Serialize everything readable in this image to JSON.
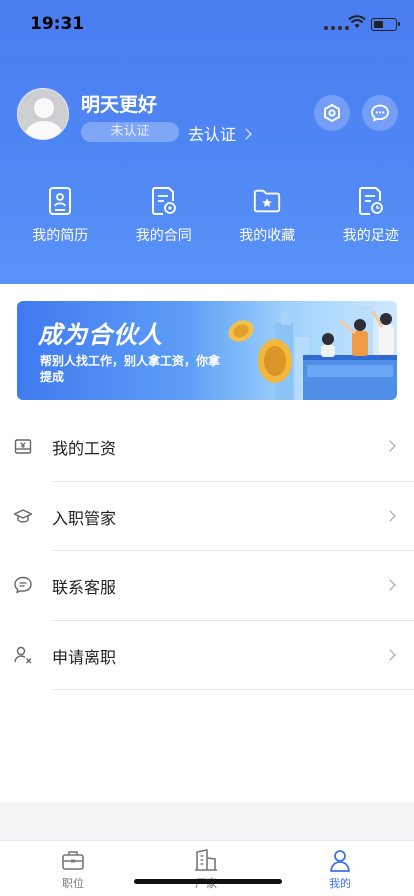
{
  "status": {
    "time": "19:31"
  },
  "profile": {
    "name": "明天更好",
    "badge": "未认证",
    "verify_link": "去认证"
  },
  "shortcuts": [
    {
      "label": "我的简历",
      "icon": "resume-icon"
    },
    {
      "label": "我的合同",
      "icon": "contract-icon"
    },
    {
      "label": "我的收藏",
      "icon": "favorites-folder-icon"
    },
    {
      "label": "我的足迹",
      "icon": "history-icon"
    }
  ],
  "banner": {
    "title": "成为合伙人",
    "subtitle": "帮别人找工作，别人拿工资，你拿提成"
  },
  "menu": [
    {
      "label": "我的工资",
      "icon": "salary-icon"
    },
    {
      "label": "入职管家",
      "icon": "onboarding-icon"
    },
    {
      "label": "联系客服",
      "icon": "customer-service-icon"
    },
    {
      "label": "申请离职",
      "icon": "resign-icon"
    }
  ],
  "tabs": [
    {
      "label": "职位",
      "icon": "briefcase-icon",
      "active": false
    },
    {
      "label": "厂家",
      "icon": "building-icon",
      "active": false
    },
    {
      "label": "我的",
      "icon": "person-icon",
      "active": true
    }
  ],
  "colors": {
    "primary": "#4a7df0",
    "tab_active": "#3d73ec"
  }
}
